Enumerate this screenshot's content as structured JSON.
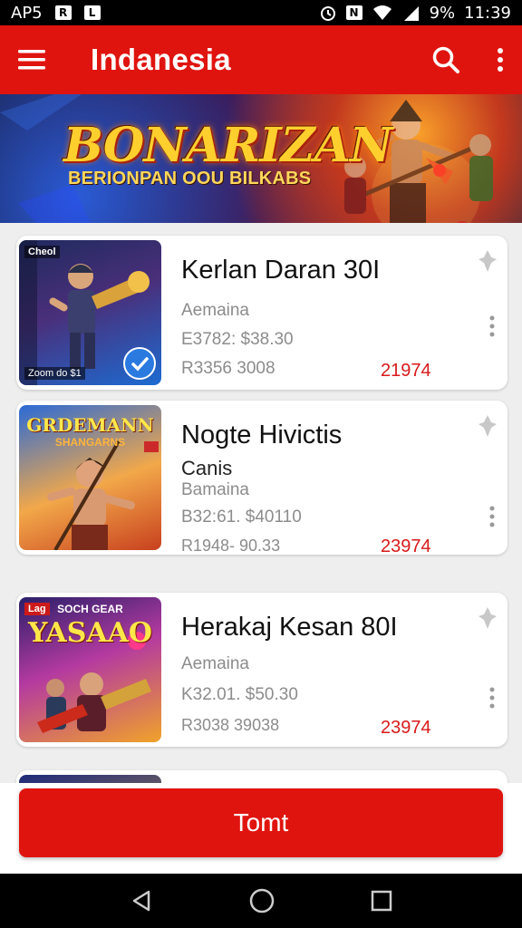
{
  "status_bar": {
    "carrier": "AP5",
    "icon_left_1": "R",
    "icon_left_2": "L",
    "battery": "9%",
    "time": "11:39"
  },
  "app_bar": {
    "title": "Indanesia",
    "menu_icon": "menu-icon",
    "search_icon": "search-icon",
    "more_icon": "more-vert-icon"
  },
  "hero": {
    "title": "BONARIZAN",
    "subtitle": "BERIONPAN OOU BILKABS"
  },
  "items": [
    {
      "thumb_label": "Cheol",
      "thumb_foot": "Zoom do $1",
      "title": "Kerlan Daran 30I",
      "subtitle": "",
      "category": "Aemaina",
      "line1": "E3782:  $38.30",
      "line2": "R3356   3008",
      "price": "21974"
    },
    {
      "thumb_title": "GRDEMANN",
      "thumb_sub": "SHANGARNS",
      "title": "Nogte Hivictis",
      "subtitle": "Canis",
      "category": "Bamaina",
      "line1": "B32:61.  $40110",
      "line2": "R1948-  90.33",
      "price": "23974"
    },
    {
      "thumb_label": "Lag",
      "thumb_title": "YASAAO",
      "thumb_sub": "SOCH GEAR",
      "title": "Herakaj Kesan 80I",
      "subtitle": "",
      "category": "Aemaina",
      "line1": "K32.01.  $50.30",
      "line2": "R3038   39038",
      "price": "23974"
    }
  ],
  "cta": {
    "label": "Tomt"
  },
  "colors": {
    "primary": "#e0140f",
    "price": "#d81a1a"
  }
}
